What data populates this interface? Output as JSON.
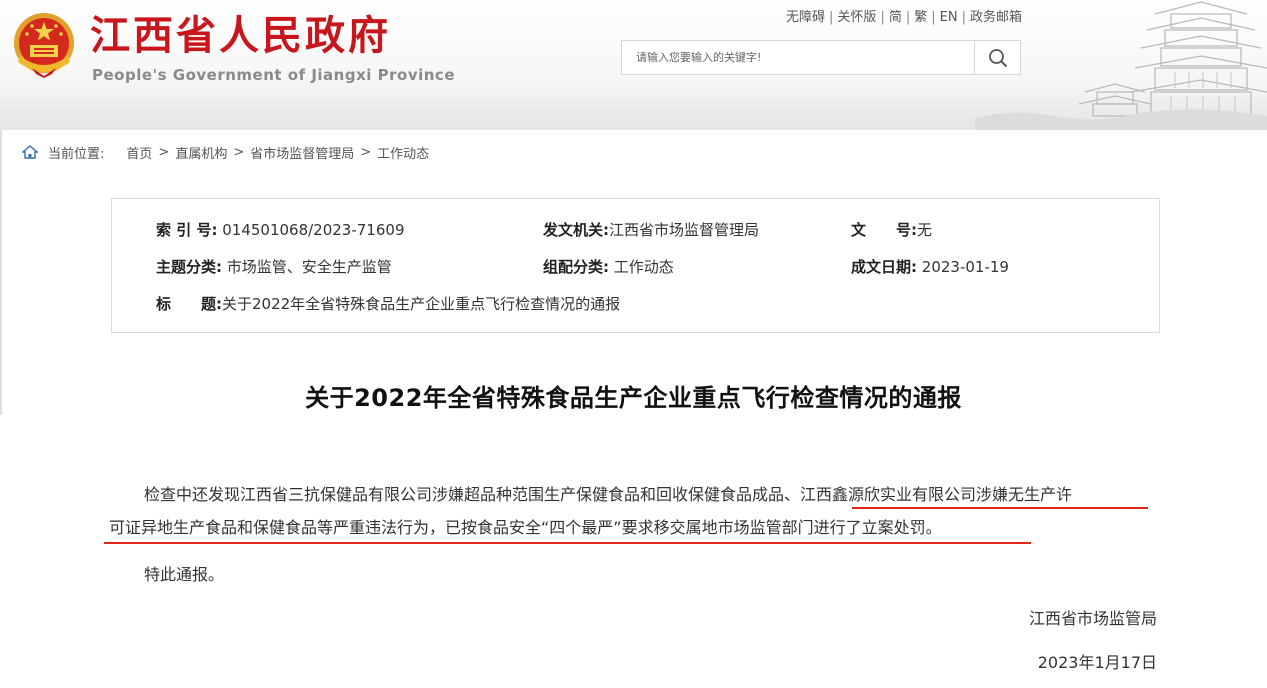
{
  "header": {
    "title": "江西省人民政府",
    "subtitle": "People's Government of Jiangxi Province",
    "top_links": [
      "无障碍",
      "关怀版",
      "简",
      "繁",
      "EN",
      "政务邮箱"
    ],
    "search_placeholder": "请输入您要输入的关键字!",
    "brand_color": "#c8161d"
  },
  "breadcrumb": {
    "label": "当前位置:",
    "items": [
      "首页",
      "直属机构",
      "省市场监督管理局",
      "工作动态"
    ]
  },
  "info": {
    "index_label": "索 引 号:",
    "index_value": "014501068/2023-71609",
    "issuer_label": "发文机关:",
    "issuer_value": "江西省市场监督管理局",
    "docno_label": "文　　号:",
    "docno_value": "无",
    "topic_label": "主题分类:",
    "topic_value": "市场监管、安全生产监管",
    "category_label": "组配分类:",
    "category_value": "工作动态",
    "date_label": "成文日期:",
    "date_value": "2023-01-19",
    "title_label": "标　　题:",
    "title_value": "关于2022年全省特殊食品生产企业重点飞行检查情况的通报"
  },
  "article": {
    "title": "关于2022年全省特殊食品生产企业重点飞行检查情况的通报",
    "para1_line1": "检查中还发现江西省三抗保健品有限公司涉嫌超品种范围生产保健食品和回收保健食品成品、江西鑫源欣实业有限公司涉嫌无生产许",
    "para1_line2": "可证异地生产食品和保健食品等严重违法行为，已按食品安全“四个最严”要求移交属地市场监管部门进行了立案处罚。",
    "para2": "特此通报。",
    "signature": "江西省市场监管局",
    "date": "2023年1月17日",
    "highlight_color": "#e1261c"
  }
}
